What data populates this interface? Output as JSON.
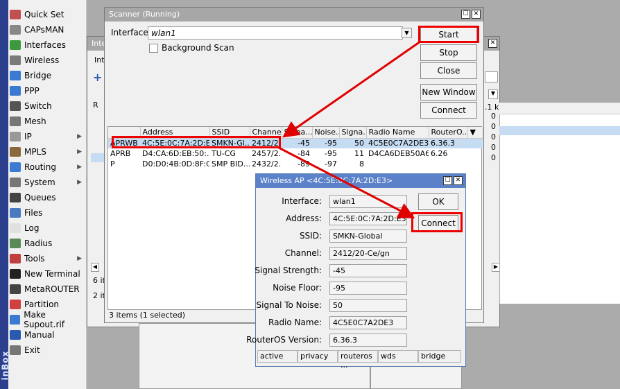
{
  "sidebar": {
    "strip_text": "inBox",
    "items": [
      {
        "label": "Quick Set",
        "icon": "quick-set-icon",
        "color": "#c05050",
        "arrow": false
      },
      {
        "label": "CAPsMAN",
        "icon": "capsman-icon",
        "color": "#888888",
        "arrow": false
      },
      {
        "label": "Interfaces",
        "icon": "interfaces-icon",
        "color": "#3c9a3c",
        "arrow": false
      },
      {
        "label": "Wireless",
        "icon": "wireless-icon",
        "color": "#7a7a7a",
        "arrow": false
      },
      {
        "label": "Bridge",
        "icon": "bridge-icon",
        "color": "#3a7ad0",
        "arrow": false
      },
      {
        "label": "PPP",
        "icon": "ppp-icon",
        "color": "#3a7ad0",
        "arrow": false
      },
      {
        "label": "Switch",
        "icon": "switch-icon",
        "color": "#555555",
        "arrow": false
      },
      {
        "label": "Mesh",
        "icon": "mesh-icon",
        "color": "#777777",
        "arrow": false
      },
      {
        "label": "IP",
        "icon": "ip-icon",
        "color": "#999999",
        "arrow": true
      },
      {
        "label": "MPLS",
        "icon": "mpls-icon",
        "color": "#8a6a3a",
        "arrow": true
      },
      {
        "label": "Routing",
        "icon": "routing-icon",
        "color": "#3a7ad0",
        "arrow": true
      },
      {
        "label": "System",
        "icon": "system-icon",
        "color": "#777777",
        "arrow": true
      },
      {
        "label": "Queues",
        "icon": "queues-icon",
        "color": "#444444",
        "arrow": false
      },
      {
        "label": "Files",
        "icon": "files-icon",
        "color": "#4a7ac0",
        "arrow": false
      },
      {
        "label": "Log",
        "icon": "log-icon",
        "color": "#e0e0e0",
        "arrow": false
      },
      {
        "label": "Radius",
        "icon": "radius-icon",
        "color": "#5a8a5a",
        "arrow": false
      },
      {
        "label": "Tools",
        "icon": "tools-icon",
        "color": "#c04040",
        "arrow": true
      },
      {
        "label": "New Terminal",
        "icon": "terminal-icon",
        "color": "#222222",
        "arrow": false
      },
      {
        "label": "MetaROUTER",
        "icon": "metarouter-icon",
        "color": "#444444",
        "arrow": false
      },
      {
        "label": "Partition",
        "icon": "partition-icon",
        "color": "#d04040",
        "arrow": false
      },
      {
        "label": "Make Supout.rif",
        "icon": "supout-icon",
        "color": "#3a7ad0",
        "arrow": false
      },
      {
        "label": "Manual",
        "icon": "manual-icon",
        "color": "#2a5ab0",
        "arrow": false
      },
      {
        "label": "Exit",
        "icon": "exit-icon",
        "color": "#777777",
        "arrow": false
      }
    ]
  },
  "bg_interface_window": {
    "title": "Inter",
    "tab": "Inte",
    "col_r": "R",
    "status1": "6 ite",
    "status2": "2 ite",
    "right_col_header": ".1 k",
    "right_values": [
      "0",
      "0",
      "0",
      "0",
      "0"
    ]
  },
  "scanner": {
    "title": "Scanner (Running)",
    "interface_label": "Interface:",
    "interface_value": "wlan1",
    "background_scan_label": "Background Scan",
    "buttons": {
      "start": "Start",
      "stop": "Stop",
      "close": "Close",
      "new_window": "New Window",
      "connect": "Connect"
    },
    "columns": [
      "",
      "Address",
      "SSID",
      "Channel",
      "Signa...",
      "Noise...",
      "Signa...",
      "Radio Name",
      "RouterO..."
    ],
    "rows": [
      {
        "flags": "APRWB",
        "address": "4C:5E:0C:7A:2D:E3",
        "ssid": "SMKN-Gl...",
        "channel": "2412/2...",
        "signal": "-45",
        "noise": "-95",
        "snr": "50",
        "radio": "4C5E0C7A2DE3",
        "ros": "6.36.3",
        "selected": true
      },
      {
        "flags": "APRB",
        "address": "D4:CA:6D:EB:50:...",
        "ssid": "TU-CG",
        "channel": "2457/2...",
        "signal": "-84",
        "noise": "-95",
        "snr": "11",
        "radio": "D4CA6DEB50A6",
        "ros": "6.26",
        "selected": false
      },
      {
        "flags": "P",
        "address": "D0:D0:4B:0D:8F:C0",
        "ssid": "SMP BID...",
        "channel": "2432/2...",
        "signal": "-89",
        "noise": "-97",
        "snr": "8",
        "radio": "",
        "ros": "",
        "selected": false
      }
    ],
    "status": "3 items (1 selected)"
  },
  "ap_window": {
    "title": "Wireless AP <4C:5E:0C:7A:2D:E3>",
    "ok_label": "OK",
    "connect_label": "Connect",
    "fields": [
      {
        "label": "Interface:",
        "value": "wlan1"
      },
      {
        "label": "Address:",
        "value": "4C:5E:0C:7A:2D:E3"
      },
      {
        "label": "SSID:",
        "value": "SMKN-Global"
      },
      {
        "label": "Channel:",
        "value": "2412/20-Ce/gn"
      },
      {
        "label": "Signal Strength:",
        "value": "-45"
      },
      {
        "label": "Noise Floor:",
        "value": "-95"
      },
      {
        "label": "Signal To Noise:",
        "value": "50"
      },
      {
        "label": "Radio Name:",
        "value": "4C5E0C7A2DE3"
      },
      {
        "label": "RouterOS Version:",
        "value": "6.36.3"
      }
    ],
    "status_cells": [
      "active",
      "privacy",
      "routeros ...",
      "wds",
      "bridge"
    ]
  },
  "colors": {
    "annotation": "#e00000",
    "selected_row": "#c6dcf2",
    "ap_title": "#5b82c9"
  }
}
